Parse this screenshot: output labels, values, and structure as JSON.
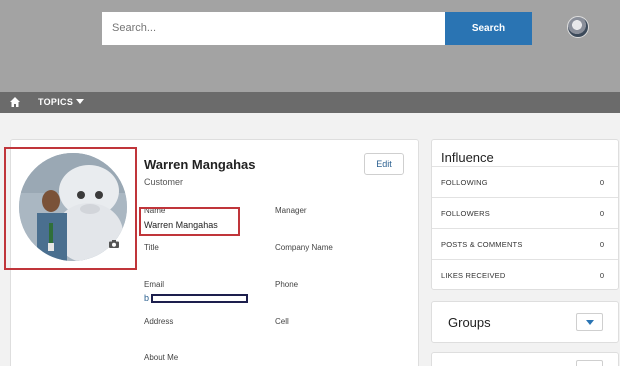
{
  "header": {
    "search_placeholder": "Search...",
    "search_button": "Search"
  },
  "nav": {
    "topics_label": "TOPICS"
  },
  "profile": {
    "name": "Warren Mangahas",
    "role": "Customer",
    "edit_label": "Edit",
    "fields": {
      "name_label": "Name",
      "name_value": "Warren Mangahas",
      "manager_label": "Manager",
      "title_label": "Title",
      "company_label": "Company Name",
      "email_label": "Email",
      "email_value": "b",
      "phone_label": "Phone",
      "address_label": "Address",
      "cell_label": "Cell",
      "about_label": "About Me"
    }
  },
  "influence": {
    "title": "Influence",
    "rows": [
      {
        "label": "FOLLOWING",
        "value": "0"
      },
      {
        "label": "FOLLOWERS",
        "value": "0"
      },
      {
        "label": "POSTS & COMMENTS",
        "value": "0"
      },
      {
        "label": "LIKES RECEIVED",
        "value": "0"
      }
    ]
  },
  "groups": {
    "title": "Groups"
  },
  "colors": {
    "accent": "#2a74b3",
    "highlight": "#c0353a",
    "header_bg": "#a3a3a3",
    "nav_bg": "#6b6b6b"
  }
}
